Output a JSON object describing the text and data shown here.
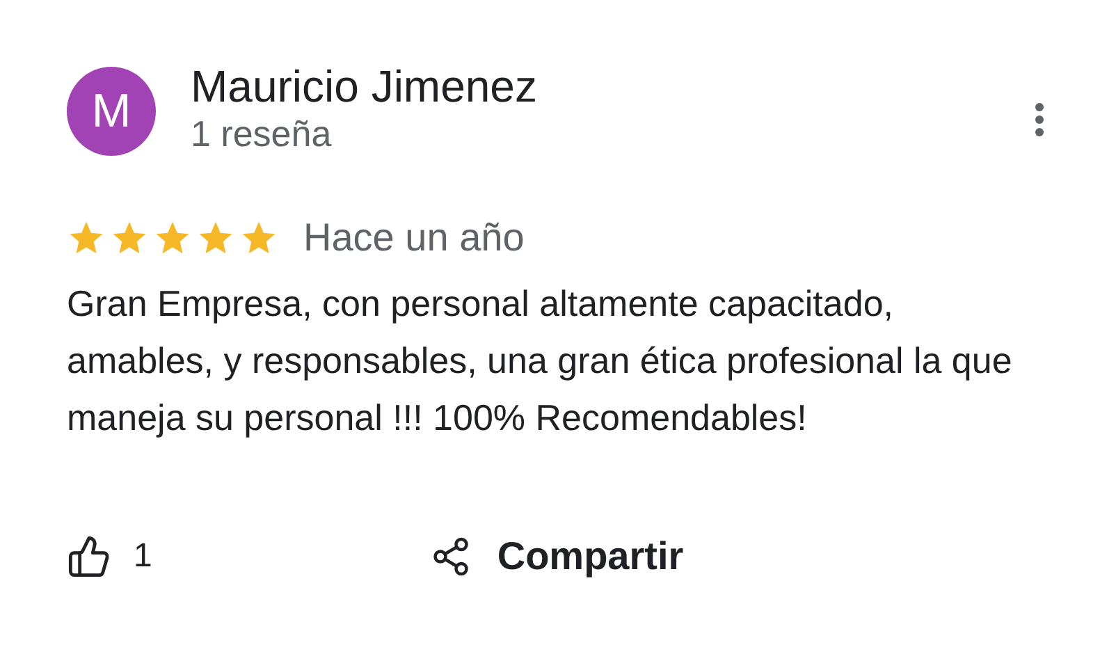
{
  "review": {
    "avatar_letter": "M",
    "author": "Mauricio Jimenez",
    "author_meta": "1 reseña",
    "stars": 5,
    "time": "Hace un año",
    "text": "Gran Empresa, con personal altamente capacitado, amables, y responsables, una gran ética profesional la que maneja su personal !!! 100% Recomendables!"
  },
  "actions": [
    {
      "kind": "like",
      "label": "1"
    },
    {
      "kind": "share",
      "label": "Compartir"
    }
  ]
}
